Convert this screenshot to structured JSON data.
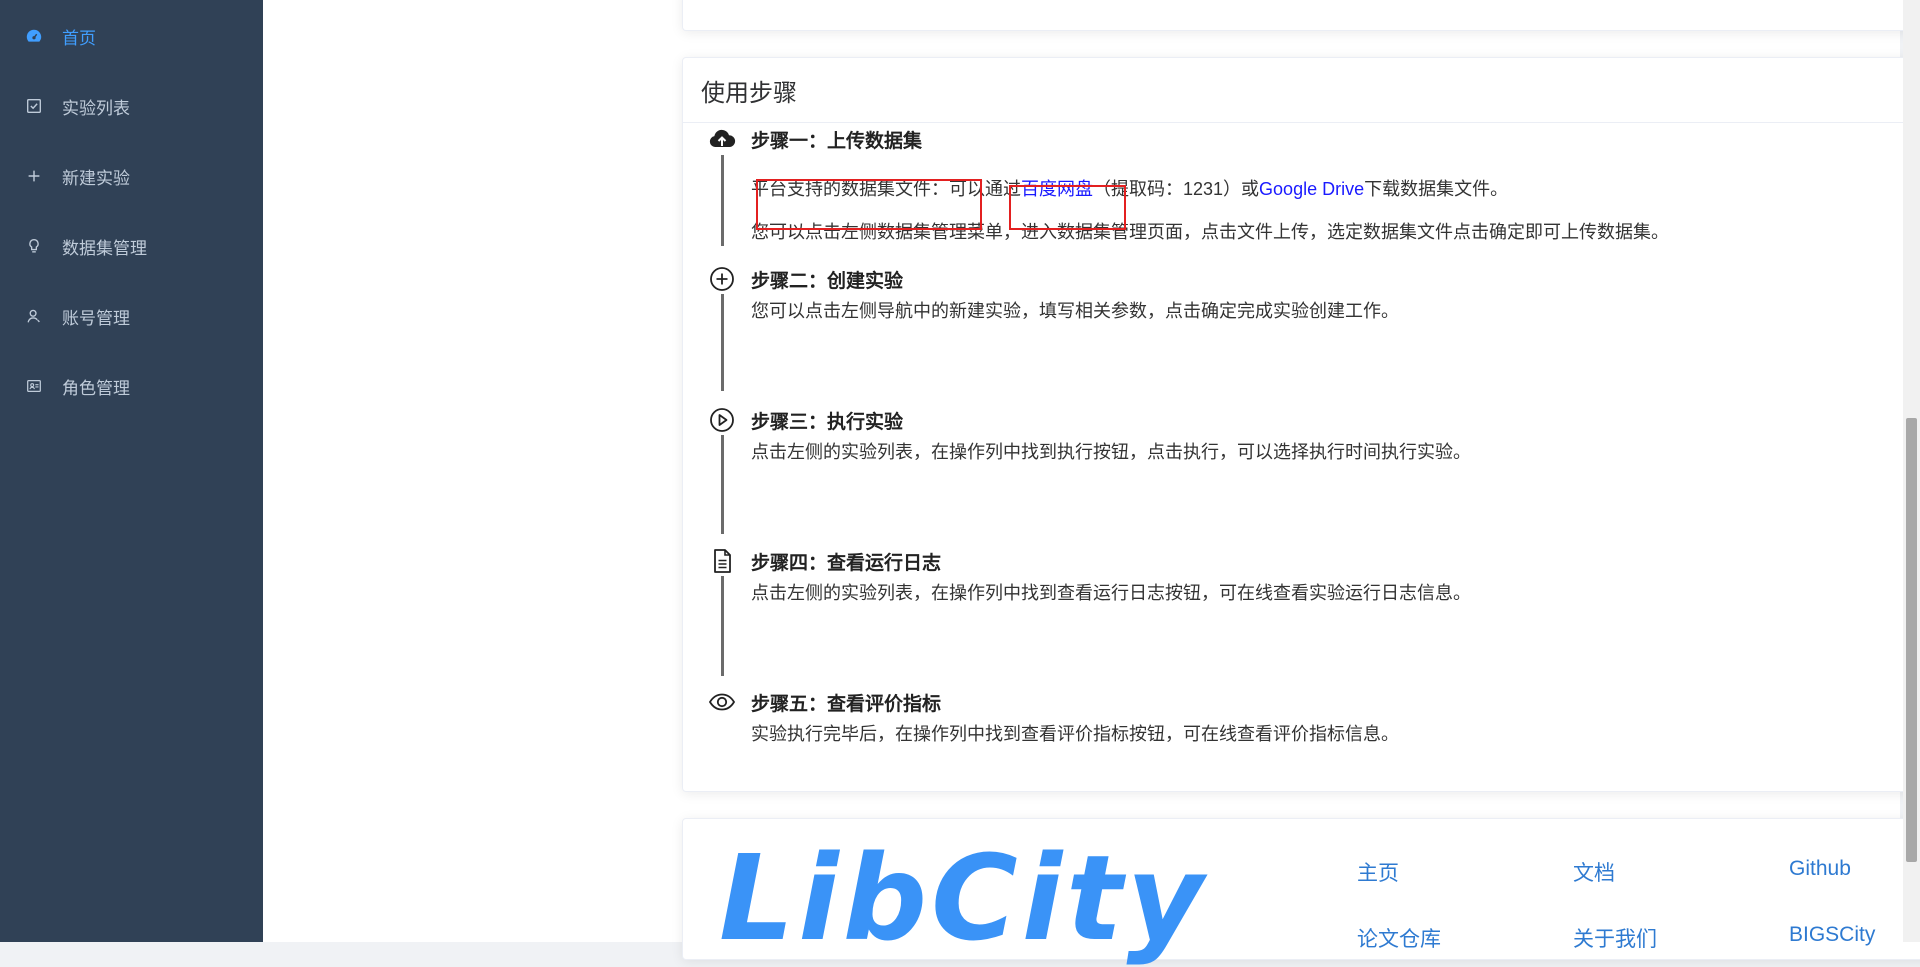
{
  "sidebar": {
    "items": [
      {
        "label": "首页",
        "icon": "dashboard-icon",
        "active": true
      },
      {
        "label": "实验列表",
        "icon": "checkbox-icon"
      },
      {
        "label": "新建实验",
        "icon": "plus-icon"
      },
      {
        "label": "数据集管理",
        "icon": "bulb-icon"
      },
      {
        "label": "账号管理",
        "icon": "user-icon"
      },
      {
        "label": "角色管理",
        "icon": "id-card-icon"
      }
    ]
  },
  "steps_card": {
    "title": "使用步骤",
    "step1": {
      "title": "步骤一：上传数据集",
      "line1_prefix": "平台支持的数据集文件：可以通过",
      "baidu_link": "百度网盘",
      "code_text": "（提取码：1231）",
      "or_text": "或",
      "google_link": "Google Drive",
      "line1_suffix": "下载数据集文件。",
      "line2": "您可以点击左侧数据集管理菜单，进入数据集管理页面，点击文件上传，选定数据集文件点击确定即可上传数据集。"
    },
    "step2": {
      "title": "步骤二：创建实验",
      "text": "您可以点击左侧导航中的新建实验，填写相关参数，点击确定完成实验创建工作。"
    },
    "step3": {
      "title": "步骤三：执行实验",
      "text": "点击左侧的实验列表，在操作列中找到执行按钮，点击执行，可以选择执行时间执行实验。"
    },
    "step4": {
      "title": "步骤四：查看运行日志",
      "text": "点击左侧的实验列表，在操作列中找到查看运行日志按钮，可在线查看实验运行日志信息。"
    },
    "step5": {
      "title": "步骤五：查看评价指标",
      "text": "实验执行完毕后，在操作列中找到查看评价指标按钮，可在线查看评价指标信息。"
    }
  },
  "footer": {
    "logo": "LibCity",
    "links": [
      "主页",
      "文档",
      "Github",
      "论文仓库",
      "关于我们",
      "BIGSCity"
    ]
  },
  "colors": {
    "sidebar_bg": "#304156",
    "sidebar_text": "#bfcbd9",
    "active": "#409eff",
    "link": "#1a1aff",
    "highlight_box": "#e32020",
    "logo": "#3a93f7"
  }
}
